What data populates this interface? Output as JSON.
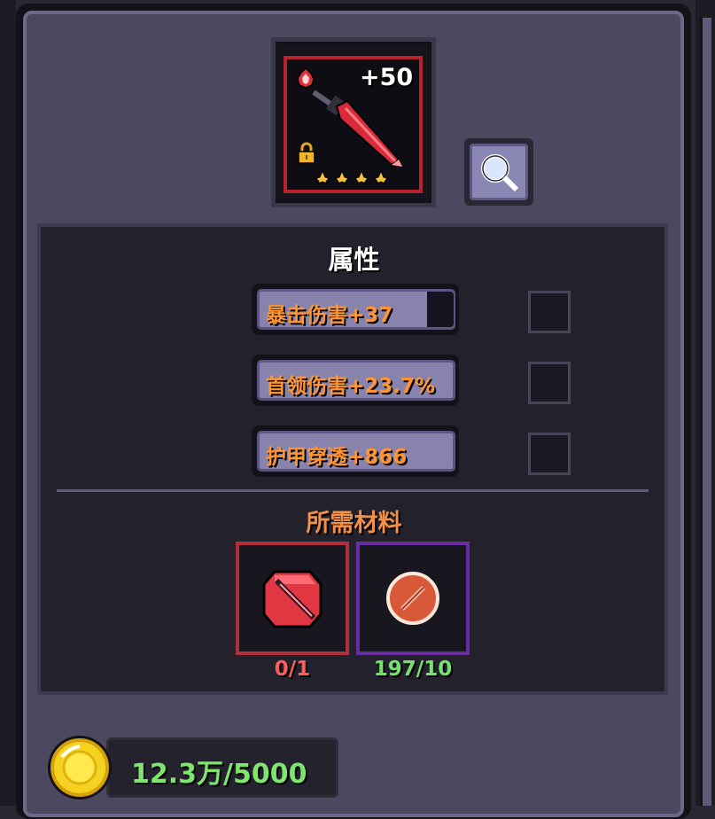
{
  "item": {
    "enhance_level": "+50",
    "slot_border_color": "#b5232d",
    "star_count": 4
  },
  "attributes": {
    "title": "属性",
    "stats": [
      {
        "label": "暴击伤害+37",
        "locked": false
      },
      {
        "label": "首领伤害+23.7%",
        "locked": false
      },
      {
        "label": "护甲穿透+866",
        "locked": false
      }
    ]
  },
  "materials": {
    "title": "所需材料",
    "items": [
      {
        "icon": "red-weapon-gem-icon",
        "count": "0/1",
        "count_color": "#ff5b5b"
      },
      {
        "icon": "orange-scroll-gem-icon",
        "count": "197/10",
        "count_color": "#72e46a"
      }
    ]
  },
  "currency": {
    "icon": "gold-coin-icon",
    "amount": "12.3万/5000"
  }
}
